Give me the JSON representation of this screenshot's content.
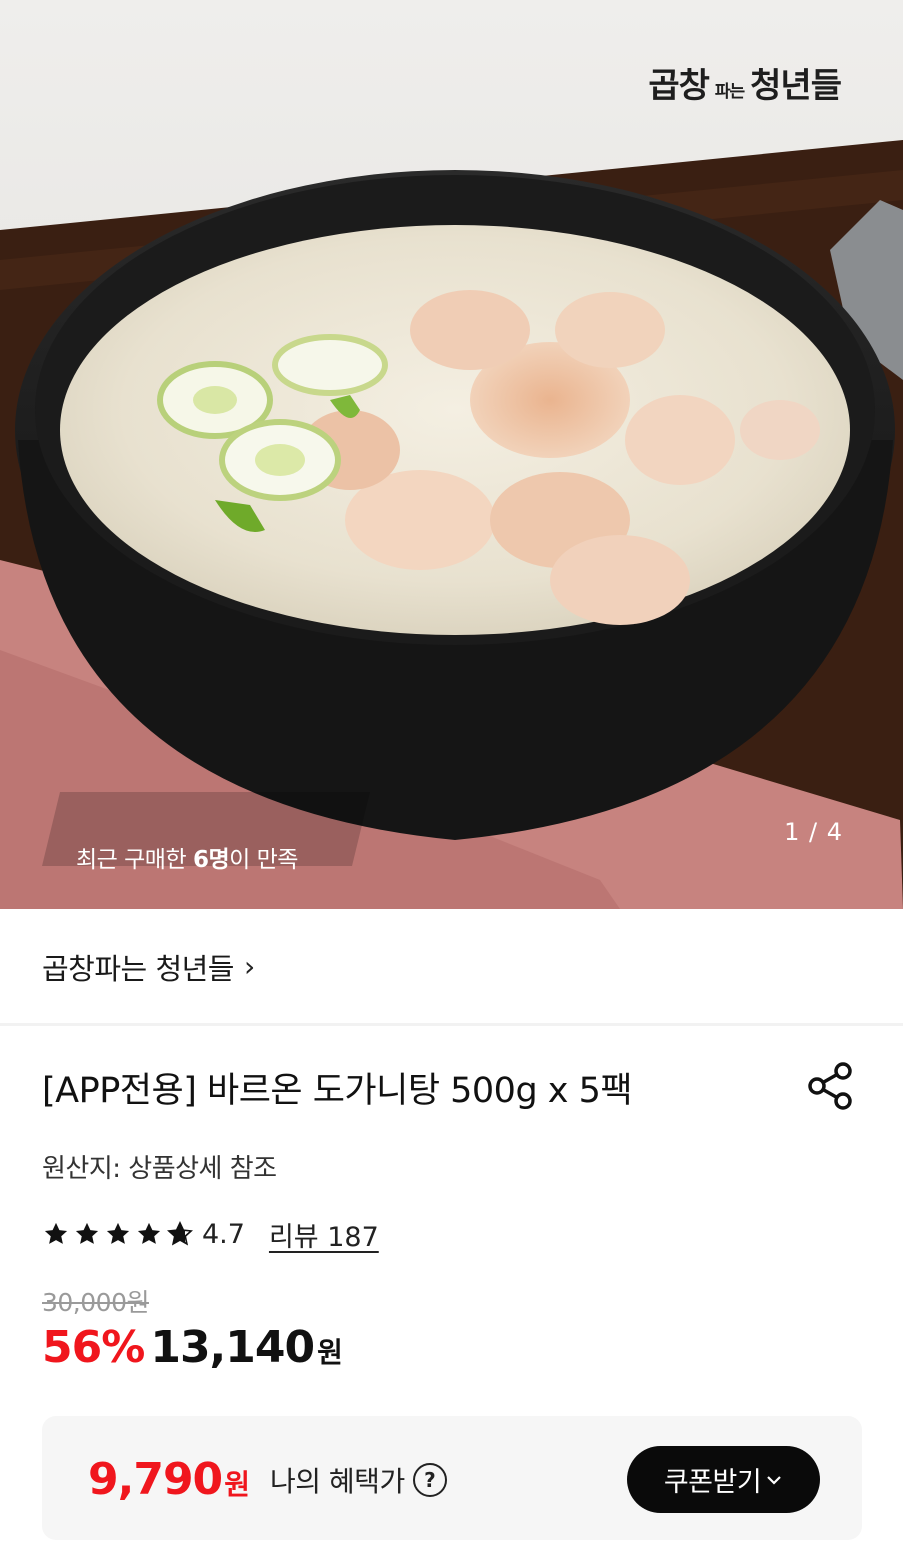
{
  "hero": {
    "brand_logo": {
      "big_1": "곱창",
      "small": "파는",
      "big_2": "청년들"
    },
    "promo_prefix": "최근 구매한 ",
    "promo_count": "6명",
    "promo_suffix": "이 만족",
    "page_counter": "1 / 4",
    "image_subject": "dogani-tang-soup-in-black-stone-bowl"
  },
  "brand": {
    "name": "곱창파는 청년들",
    "chevron": "›"
  },
  "product": {
    "title": "[APP전용] 바르온 도가니탕 500g x 5팩",
    "origin": "원산지: 상품상세 참조",
    "rating": 4.7,
    "rating_text": "4.7",
    "review_link": "리뷰 187",
    "original_price": "30,000원",
    "discount": "56%",
    "sale_price": "13,140",
    "currency": "원"
  },
  "benefit": {
    "price": "9,790",
    "currency": "원",
    "label": "나의 혜택가",
    "help_glyph": "?",
    "coupon_button": "쿠폰받기",
    "coupon_chevron": "⌄"
  },
  "colors": {
    "accent_red": "#f0161d",
    "button_black": "#0a0a0a",
    "benefit_bg": "#f6f6f6"
  },
  "icons": [
    "share-icon",
    "star-icon",
    "star-half-icon",
    "chevron-right-icon",
    "help-icon",
    "chevron-down-icon"
  ]
}
